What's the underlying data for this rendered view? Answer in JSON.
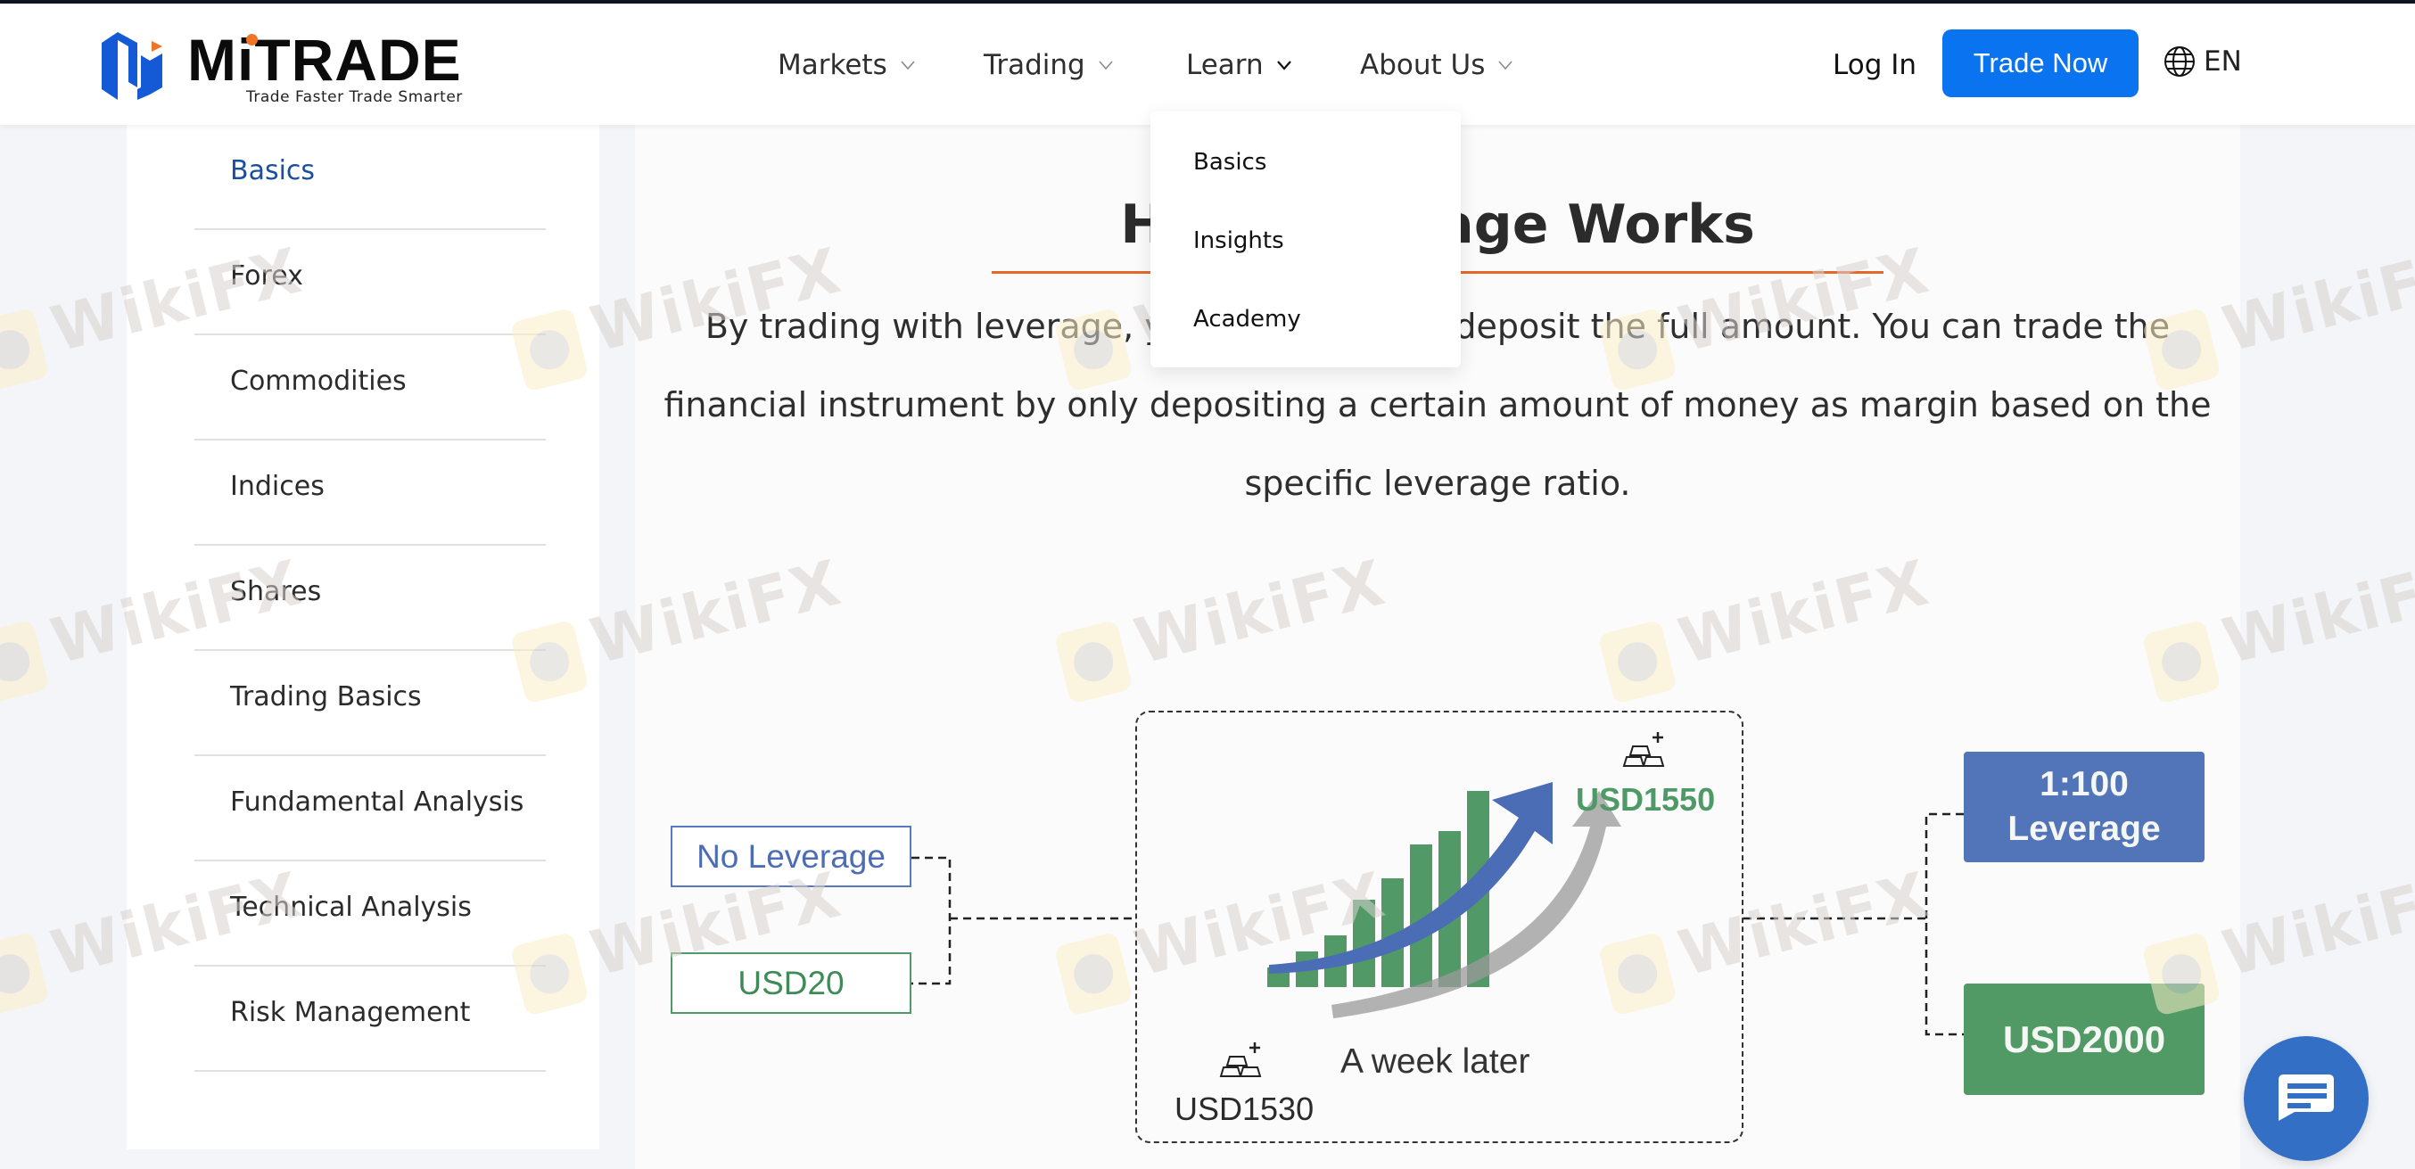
{
  "brand": {
    "name": "MiTRADE",
    "tagline": "Trade Faster Trade Smarter",
    "colors": {
      "primary_blue": "#0a73f0",
      "logo_blue": "#1459d6",
      "logo_orange": "#f07427",
      "accent_orange": "#e3692b",
      "active_link": "#1a4f9e"
    }
  },
  "header": {
    "nav": [
      {
        "label": "Markets",
        "icon": "chevron-down-icon",
        "expanded": false
      },
      {
        "label": "Trading",
        "icon": "chevron-down-icon",
        "expanded": false
      },
      {
        "label": "Learn",
        "icon": "chevron-down-icon",
        "expanded": true
      },
      {
        "label": "About Us",
        "icon": "chevron-down-icon",
        "expanded": false
      }
    ],
    "login_label": "Log In",
    "cta_label": "Trade Now",
    "language": {
      "icon": "globe-icon",
      "label": "EN"
    }
  },
  "learn_dropdown": {
    "items": [
      "Basics",
      "Insights",
      "Academy"
    ]
  },
  "sidebar": {
    "active_index": 0,
    "items": [
      {
        "label": "Basics"
      },
      {
        "label": "Forex"
      },
      {
        "label": "Commodities"
      },
      {
        "label": "Indices"
      },
      {
        "label": "Shares"
      },
      {
        "label": "Trading Basics"
      },
      {
        "label": "Fundamental Analysis"
      },
      {
        "label": "Technical Analysis"
      },
      {
        "label": "Risk Management"
      }
    ]
  },
  "article": {
    "heading": "How Leverage Works",
    "paragraph": "By trading with leverage, you don't need to deposit the full amount. You can trade the financial instrument by only depositing a certain amount of money as margin based on the specific leverage ratio."
  },
  "diagram": {
    "left": {
      "mode_label": "No Leverage",
      "amount_label": "USD20"
    },
    "center": {
      "start_price": "USD1530",
      "end_price": "USD1550",
      "caption": "A week later",
      "icon": "gold-bars-icon"
    },
    "right": {
      "mode_label": "1:100 Leverage",
      "mode_line1": "1:100",
      "mode_line2": "Leverage",
      "amount_label": "USD2000"
    },
    "colors": {
      "blue": "#5274b8",
      "green": "#519a66",
      "text_green": "#4e9a66"
    }
  },
  "chat": {
    "icon": "chat-bubble-icon"
  },
  "watermark": {
    "text": "WikiFX"
  }
}
